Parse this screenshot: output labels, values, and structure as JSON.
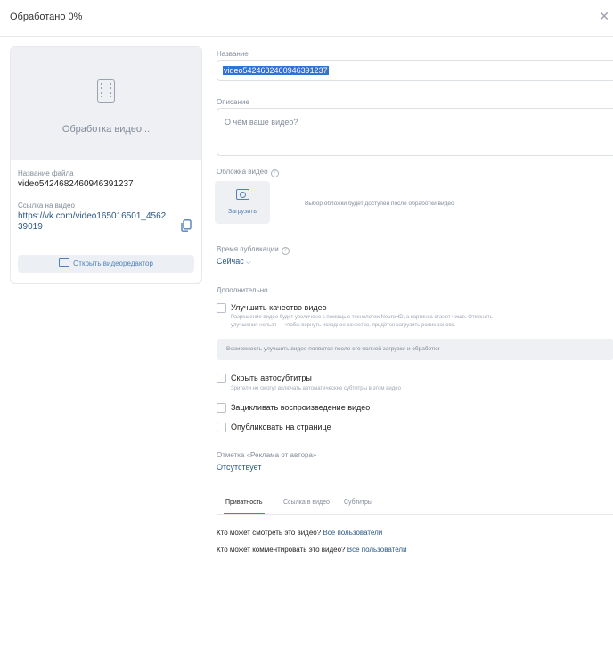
{
  "header": {
    "title": "Обработано 0%",
    "close_icon": "close-icon"
  },
  "preview": {
    "status": "Обработка видео...",
    "icon": "film-icon"
  },
  "file": {
    "name_label": "Название файла",
    "name_value": "video5424682460946391237"
  },
  "link": {
    "label": "Ссылка на видео",
    "value": "https://vk.com/video165016501_456239019",
    "copy_icon": "copy-icon"
  },
  "editor_button": {
    "label": "Открыть видеоредактор",
    "icon": "video-editor-icon"
  },
  "form": {
    "name_label": "Название",
    "name_value": "video5424682460946391237",
    "desc_label": "Описание",
    "desc_placeholder": "О чём ваше видео?",
    "cover_label": "Обложка видео",
    "upload_label": "Загрузить",
    "cover_hint": "Выбор обложки будет доступен после обработки видео",
    "pubtime_label": "Время публикации",
    "pubtime_value": "Сейчас",
    "extra_label": "Дополнительно",
    "enhance_label": "Улучшить качество видео",
    "enhance_desc_1": "Разрешение видео будет увеличено с помощью технологии NeuroHD, а картинка станет чище. Отменить",
    "enhance_desc_2": "улучшения нельзя — чтобы вернуть исходное качество, придётся загрузить ролик заново.",
    "enhance_info": "Возможность улучшить видео появится после его полной загрузки и обработки",
    "subs_label": "Скрыть автосубтитры",
    "subs_desc": "Зрители не смогут включать автоматические субтитры в этом видео",
    "loop_label": "Зацикливать воспроизведение видео",
    "publish_label": "Опубликовать на странице",
    "ad_label": "Отметка «Реклама от автора»",
    "ad_value": "Отсутствует"
  },
  "tabs": [
    "Приватность",
    "Ссылка в видео",
    "Субтитры"
  ],
  "privacy": {
    "view_q": "Кто может смотреть это видео?",
    "view_a": "Все пользователи",
    "comment_q": "Кто может комментировать это видео?",
    "comment_a": "Все пользователи"
  }
}
